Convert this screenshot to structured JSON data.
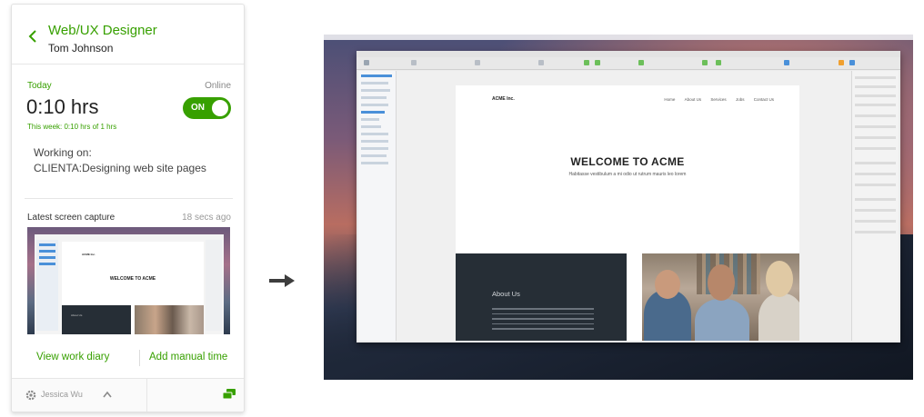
{
  "tracker": {
    "job_title": "Web/UX Designer",
    "user_name": "Tom Johnson",
    "today_label": "Today",
    "status_label": "Online",
    "hours": "0:10 hrs",
    "toggle_label": "ON",
    "toggle_on": true,
    "week_summary": "This week: 0:10 hrs of 1 hrs",
    "working_on_label": "Working on:",
    "working_on_value": "CLIENTA:Designing web site pages",
    "capture_label": "Latest screen capture",
    "capture_time": "18 secs ago",
    "link_diary": "View work diary",
    "link_manual": "Add manual time",
    "footer_user": "Jessica Wu",
    "accent_color": "#37a000"
  },
  "thumbnail": {
    "logo": "ACME Inc.",
    "welcome": "WELCOME TO ACME",
    "about": "About Us"
  },
  "screen": {
    "site_logo": "ACME Inc.",
    "nav": [
      "Home",
      "About Us",
      "Services",
      "Jobs",
      "Contact Us"
    ],
    "hero_title": "WELCOME TO ACME",
    "hero_subtitle": "Habitasse vestibulum a mi odio ut rutrum mauris leo lorem",
    "about_title": "About Us"
  },
  "icons": {
    "back": "chevron-left-icon",
    "settings": "gear-icon",
    "expand": "chevron-up-icon",
    "chat": "chat-icon",
    "arrow": "arrow-right-icon"
  }
}
